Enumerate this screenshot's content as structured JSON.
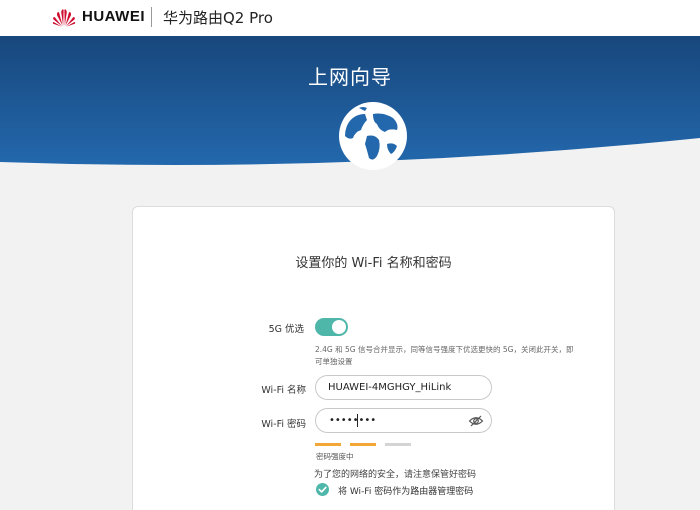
{
  "header": {
    "brand": "HUAWEI",
    "product": "华为路由Q2 Pro",
    "brand_color": "#cf0a2c"
  },
  "banner": {
    "title": "上网向导",
    "color": "#1d5590"
  },
  "card": {
    "title": "设置你的 Wi-Fi 名称和密码",
    "five_g": {
      "label": "5G 优选",
      "enabled": true,
      "hint": "2.4G 和 5G 信号合并显示，同等信号强度下优选更快的 5G，关闭此开关，即可单独设置"
    },
    "wifi_name": {
      "label": "Wi-Fi 名称",
      "value": "HUAWEI-4MGHGY_HiLink"
    },
    "wifi_password": {
      "label": "Wi-Fi 密码",
      "masked_value": "••••••••",
      "visibility_icon": "eye-hidden-icon"
    },
    "password_strength": {
      "label": "密码强度中",
      "level": 2,
      "max": 3,
      "color": "#f2a737"
    },
    "security_note": "为了您的网络的安全，请注意保管好密码",
    "admin_checkbox": {
      "label": "将 Wi-Fi 密码作为路由器管理密码",
      "checked": true
    },
    "accent_color": "#4fb7a9"
  }
}
